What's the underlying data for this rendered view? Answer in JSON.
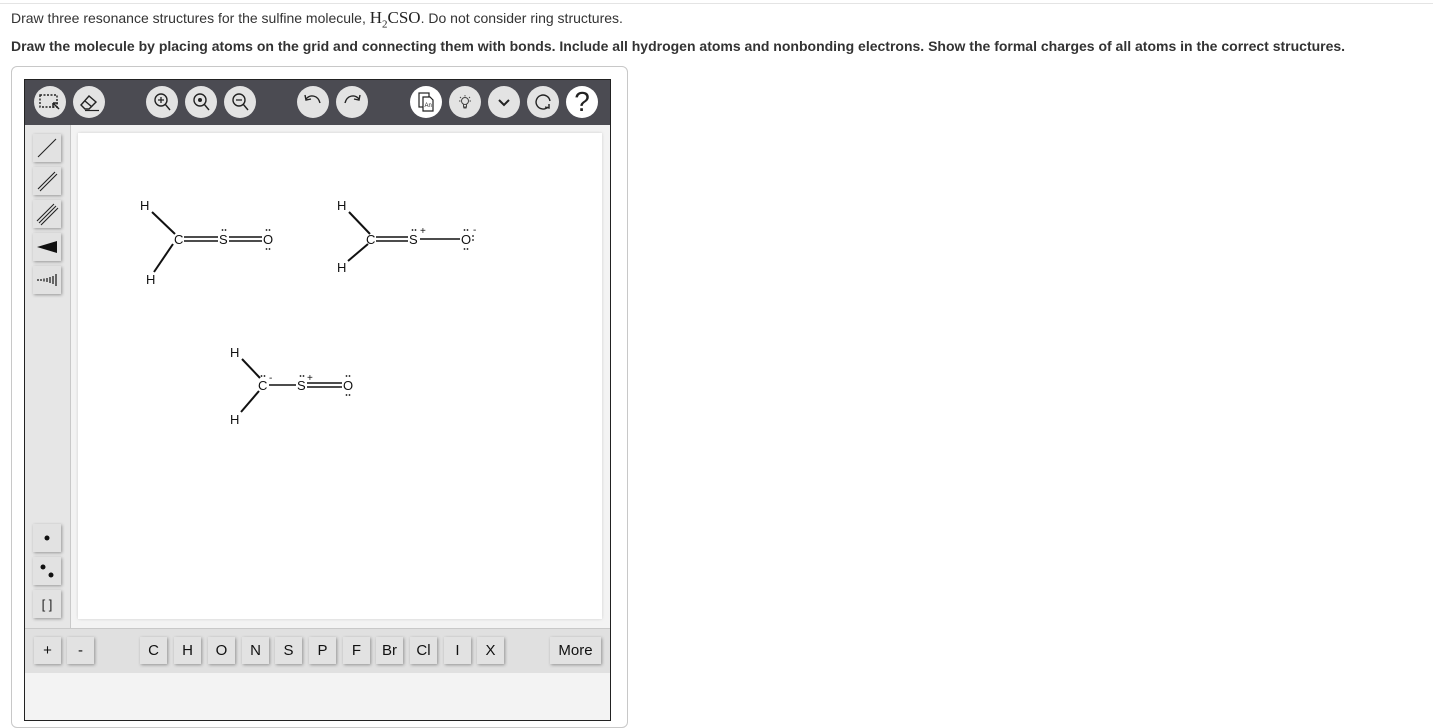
{
  "question": {
    "line1_prefix": "Draw three resonance structures for the sulfine molecule, ",
    "formula_h": "H",
    "formula_sub": "2",
    "formula_rest": "CSO",
    "line1_suffix": ". Do not consider ring structures.",
    "line2": "Draw the molecule by placing atoms on the grid and connecting them with bonds. Include all hydrogen atoms and nonbonding electrons. Show the formal charges of all atoms in the correct structures."
  },
  "toolbar": {
    "buttons": [
      {
        "name": "select-tool",
        "icon": "marquee-select-icon"
      },
      {
        "name": "eraser-tool",
        "icon": "eraser-icon"
      },
      {
        "name": "zoom-in",
        "icon": "zoom-in-icon"
      },
      {
        "name": "zoom-reset",
        "icon": "zoom-reset-icon"
      },
      {
        "name": "zoom-out",
        "icon": "zoom-out-icon"
      },
      {
        "name": "undo",
        "icon": "undo-icon"
      },
      {
        "name": "redo",
        "icon": "redo-icon"
      },
      {
        "name": "templates",
        "icon": "templates-icon",
        "label": "An"
      },
      {
        "name": "hint",
        "icon": "lightbulb-icon"
      },
      {
        "name": "more-options",
        "icon": "chevron-down-icon"
      },
      {
        "name": "reset",
        "icon": "refresh-icon"
      },
      {
        "name": "help",
        "icon": "help-icon",
        "label": "?"
      }
    ]
  },
  "left_tools": {
    "bonds": [
      "single-bond",
      "double-bond",
      "triple-bond",
      "wedge-bond",
      "hash-bond"
    ],
    "electrons": [
      "lone-electron",
      "electron-pair",
      "bracket"
    ],
    "bracket_label": "[ ]"
  },
  "bottom_bar": {
    "charges": [
      "+",
      "-"
    ],
    "atoms": [
      "C",
      "H",
      "O",
      "N",
      "S",
      "P",
      "F",
      "Br",
      "Cl",
      "I",
      "X"
    ],
    "more_label": "More"
  },
  "structures": [
    {
      "name": "structure-1",
      "atoms": {
        "H_top": "H",
        "H_bottom": "H",
        "C": "C",
        "S": "S",
        "O": "O"
      },
      "bonds": {
        "C_S": "double",
        "S_O": "double"
      },
      "charges": {}
    },
    {
      "name": "structure-2",
      "atoms": {
        "H_top": "H",
        "H_bottom": "H",
        "C": "C",
        "S": "S",
        "O": "O"
      },
      "bonds": {
        "C_S": "double",
        "S_O": "single"
      },
      "charges": {
        "S": "+",
        "O": "-"
      }
    },
    {
      "name": "structure-3",
      "atoms": {
        "H_top": "H",
        "H_bottom": "H",
        "C": "C",
        "S": "S",
        "O": "O"
      },
      "bonds": {
        "C_S": "single",
        "S_O": "double"
      },
      "charges": {
        "C": "-",
        "S": "+"
      }
    }
  ]
}
